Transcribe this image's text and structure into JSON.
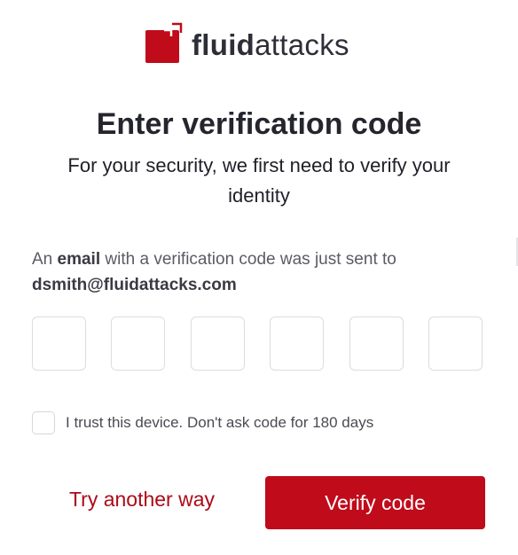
{
  "logo": {
    "bold": "fluid",
    "light": "attacks",
    "icon": "fluidattacks-logo-icon",
    "brand_color": "#bf0b1a"
  },
  "heading": {
    "title": "Enter verification code",
    "subtitle": "For your security, we first need to verify your identity"
  },
  "message": {
    "prefix": "An",
    "method": "email",
    "suffix": "with a verification code was just sent to",
    "email": "dsmith@fluidattacks.com"
  },
  "code": {
    "digits": [
      "",
      "",
      "",
      "",
      "",
      ""
    ]
  },
  "trust": {
    "checked": false,
    "label": "I trust this device. Don't ask code for 180 days"
  },
  "actions": {
    "try_another": "Try another way",
    "verify": "Verify code"
  }
}
